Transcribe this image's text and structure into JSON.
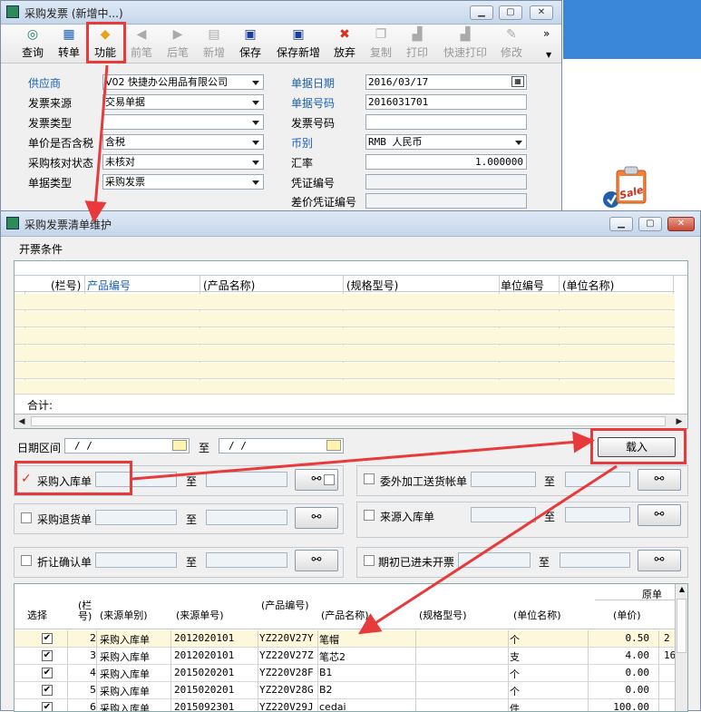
{
  "win1": {
    "title": "采购发票 (新增中...)"
  },
  "toolbar": [
    {
      "label": "查询",
      "icon": "◎",
      "disabled": false
    },
    {
      "label": "转单",
      "icon": "▦",
      "disabled": false
    },
    {
      "label": "功能",
      "icon": "◆",
      "disabled": false
    },
    {
      "label": "前笔",
      "icon": "◀",
      "disabled": true
    },
    {
      "label": "后笔",
      "icon": "▶",
      "disabled": true
    },
    {
      "label": "新增",
      "icon": "▤",
      "disabled": true
    },
    {
      "label": "保存",
      "icon": "▣",
      "disabled": false
    },
    {
      "label": "保存新增",
      "icon": "▣",
      "disabled": false
    },
    {
      "label": "放弃",
      "icon": "✖",
      "disabled": false
    },
    {
      "label": "复制",
      "icon": "❐",
      "disabled": true
    },
    {
      "label": "打印",
      "icon": "▟",
      "disabled": true
    },
    {
      "label": "快速打印",
      "icon": "▟",
      "disabled": true
    },
    {
      "label": "修改",
      "icon": "✎",
      "disabled": true
    }
  ],
  "toolbar_more": "»",
  "form": {
    "supplier_label": "供应商",
    "supplier_value": "V02 快捷办公用品有限公司",
    "source_label": "发票来源",
    "source_value": "交易单据",
    "type_label": "发票类型",
    "type_value": "",
    "tax_label": "单价是否含税",
    "tax_value": "含税",
    "check_label": "采购核对状态",
    "check_value": "未核对",
    "doctype_label": "单据类型",
    "doctype_value": "采购发票",
    "date_label": "单据日期",
    "date_value": "2016/03/17",
    "docno_label": "单据号码",
    "docno_value": "2016031701",
    "invno_label": "发票号码",
    "invno_value": "",
    "currency_label": "币别",
    "currency_value": "RMB 人民币",
    "rate_label": "汇率",
    "rate_value": "1.000000",
    "voucher_label": "凭证编号",
    "voucher_value": "",
    "diffvoucher_label": "差价凭证编号",
    "diffvoucher_value": ""
  },
  "side": {
    "sale_text": "Sale"
  },
  "win2": {
    "title": "采购发票清单维护"
  },
  "section": {
    "title": "开票条件"
  },
  "grid1": {
    "headers": [
      "(栏号)",
      "产品编号",
      "(产品名称)",
      "(规格型号)",
      "单位编号",
      "(单位名称)"
    ],
    "total_label": "合计:"
  },
  "filters": {
    "date_label": "日期区间",
    "date_from": "/ /",
    "date_to": "/ /",
    "to": "至",
    "load_button": "载入",
    "purchase_in_label": "采购入库单",
    "purchase_in_checked": true,
    "outsource_label": "委外加工送货帐单",
    "purchase_return_label": "采购退货单",
    "source_in_label": "来源入库单",
    "discount_label": "折让确认单",
    "opening_label": "期初已进未开票"
  },
  "grid2": {
    "top_header": "原单",
    "headers": [
      "选择",
      "(栏号)",
      "(来源单别)",
      "(来源单号)",
      "(产品编号)",
      "(产品名称)",
      "(规格型号)",
      "(单位名称)",
      "(单价)"
    ],
    "rows": [
      {
        "no": "2",
        "type": "采购入库单",
        "docno": "2012020101",
        "code": "YZ220V27Y",
        "name": "笔帽",
        "spec": "",
        "unit": "个",
        "price": "0.50",
        "extra": "2"
      },
      {
        "no": "3",
        "type": "采购入库单",
        "docno": "2012020101",
        "code": "YZ220V27Z",
        "name": "笔芯2",
        "spec": "",
        "unit": "支",
        "price": "4.00",
        "extra": "16"
      },
      {
        "no": "4",
        "type": "采购入库单",
        "docno": "2015020201",
        "code": "YZ220V28F",
        "name": "B1",
        "spec": "",
        "unit": "个",
        "price": "0.00",
        "extra": ""
      },
      {
        "no": "5",
        "type": "采购入库单",
        "docno": "2015020201",
        "code": "YZ220V28G",
        "name": "B2",
        "spec": "",
        "unit": "个",
        "price": "0.00",
        "extra": ""
      },
      {
        "no": "6",
        "type": "采购入库单",
        "docno": "2015092301",
        "code": "YZ220V29J",
        "name": "cedai",
        "spec": "",
        "unit": "件",
        "price": "100.00",
        "extra": ""
      }
    ]
  },
  "colors": {
    "highlight": "#e83a3a",
    "label_blue": "#1a5fb4",
    "row_yellow": "#fdf7dc"
  }
}
